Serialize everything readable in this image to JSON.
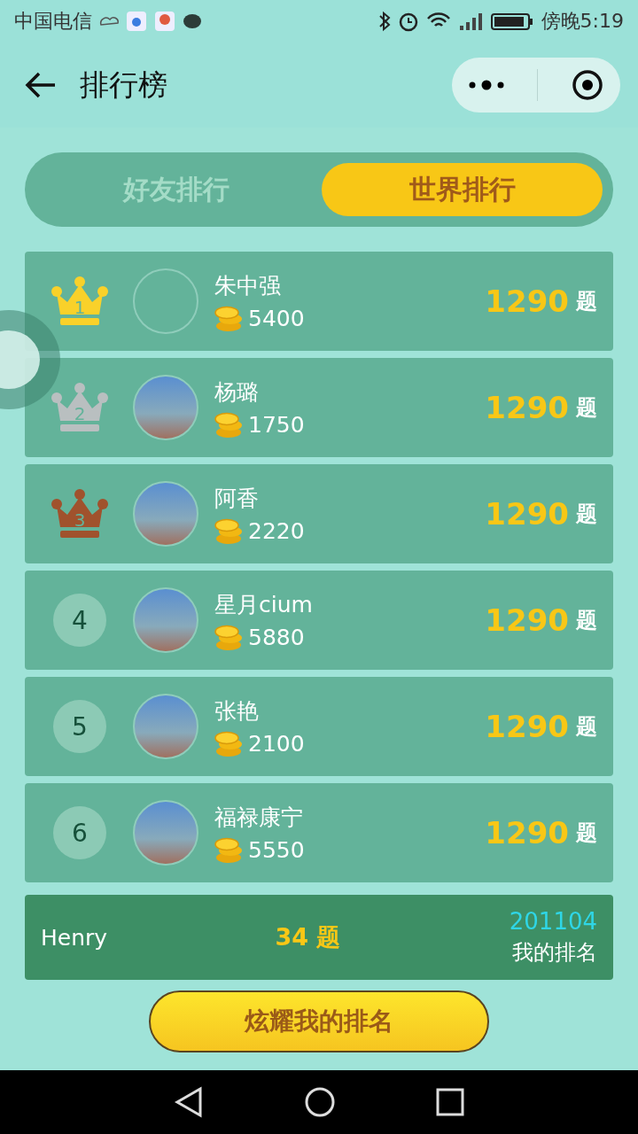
{
  "status_bar": {
    "carrier": "中国电信",
    "time": "傍晚5:19"
  },
  "header": {
    "title": "排行榜"
  },
  "tabs": [
    {
      "label": "好友排行",
      "selected": false
    },
    {
      "label": "世界排行",
      "selected": true
    }
  ],
  "rows": [
    {
      "rank": "1",
      "kind": "crown",
      "color": "#f9d12a",
      "photo": false,
      "name": "朱中强",
      "coins": "5400",
      "score": "1290",
      "unit": "题"
    },
    {
      "rank": "2",
      "kind": "crown",
      "color": "#b9bfc0",
      "photo": true,
      "name": "杨璐",
      "coins": "1750",
      "score": "1290",
      "unit": "题"
    },
    {
      "rank": "3",
      "kind": "crown",
      "color": "#a0522d",
      "photo": true,
      "name": "阿香",
      "coins": "2220",
      "score": "1290",
      "unit": "题"
    },
    {
      "rank": "4",
      "kind": "badge",
      "photo": true,
      "name": "星月cium",
      "coins": "5880",
      "score": "1290",
      "unit": "题"
    },
    {
      "rank": "5",
      "kind": "badge",
      "photo": true,
      "name": "张艳",
      "coins": "2100",
      "score": "1290",
      "unit": "题"
    },
    {
      "rank": "6",
      "kind": "badge",
      "photo": true,
      "name": "福禄康宁",
      "coins": "5550",
      "score": "1290",
      "unit": "题"
    }
  ],
  "my_rank": {
    "name": "Henry",
    "score": "34 题",
    "rank": "201104",
    "label": "我的排名"
  },
  "share_button": "炫耀我的排名"
}
